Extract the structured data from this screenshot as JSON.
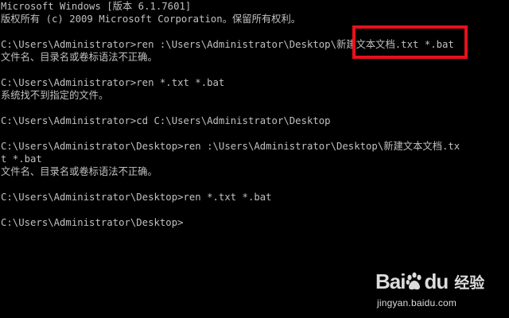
{
  "console": {
    "lines": [
      "Microsoft Windows [版本 6.1.7601]",
      "版权所有 (c) 2009 Microsoft Corporation。保留所有权利。",
      "",
      "C:\\Users\\Administrator>ren :\\Users\\Administrator\\Desktop\\新建文本文档.txt *.bat",
      "文件名、目录名或卷标语法不正确。",
      "",
      "C:\\Users\\Administrator>ren *.txt *.bat",
      "系统找不到指定的文件。",
      "",
      "C:\\Users\\Administrator>cd C:\\Users\\Administrator\\Desktop",
      "",
      "C:\\Users\\Administrator\\Desktop>ren :\\Users\\Administrator\\Desktop\\新建文本文档.tx",
      "t *.bat",
      "文件名、目录名或卷标语法不正确。",
      "",
      "C:\\Users\\Administrator\\Desktop>ren *.txt *.bat",
      "",
      "C:\\Users\\Administrator\\Desktop>"
    ]
  },
  "highlight": {
    "color": "#e8101a"
  },
  "watermark": {
    "brand_left": "Bai",
    "brand_right": "du",
    "product": "经验",
    "url": "jingyan.baidu.com",
    "paw_icon": "baidu-paw-icon"
  }
}
